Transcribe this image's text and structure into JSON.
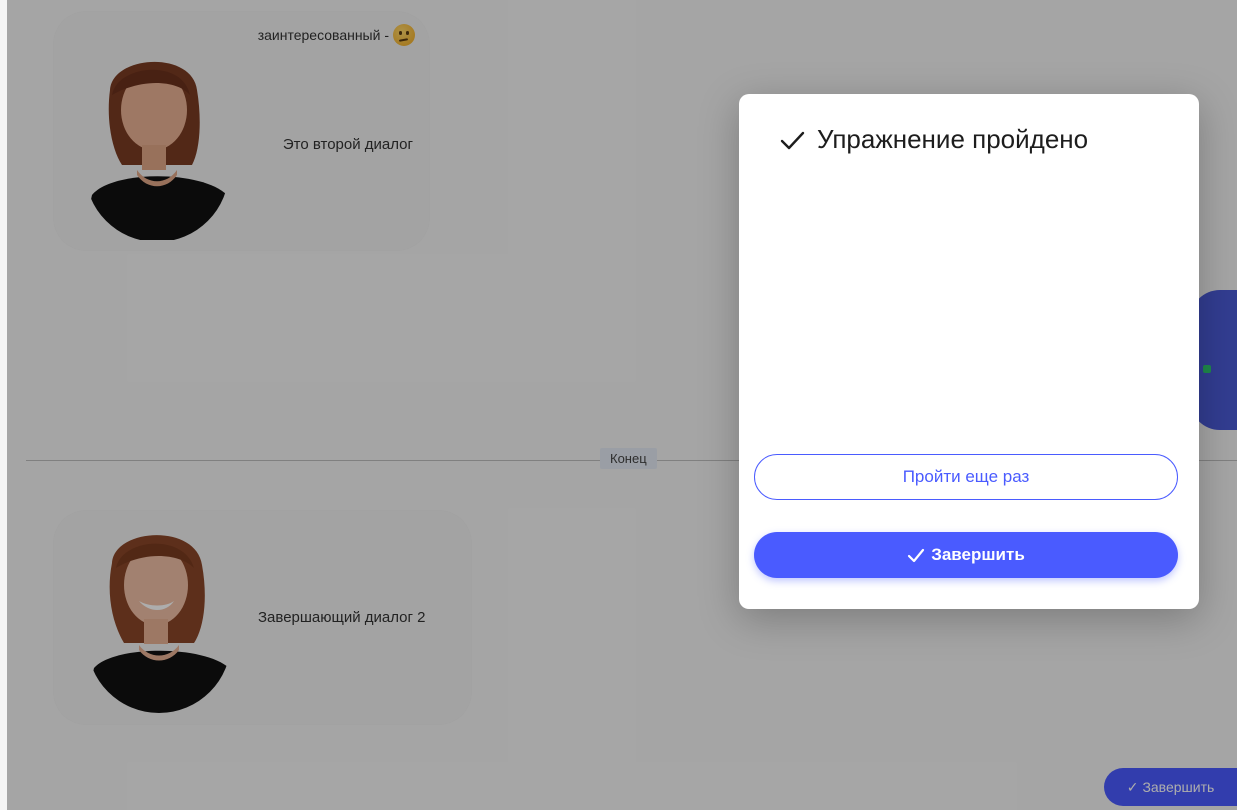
{
  "dialogs": [
    {
      "mood_label": "заинтересованный -",
      "mood_icon": "thinking-face-emoji",
      "text": "Это второй диалог"
    },
    {
      "text": "Завершающий диалог 2"
    }
  ],
  "divider": {
    "label": "Конец"
  },
  "fab": {
    "label": "Завершить",
    "icon": "check-icon"
  },
  "modal": {
    "title": "Упражнение пройдено",
    "title_icon": "check-icon",
    "retry_label": "Пройти еще раз",
    "finish_label": "Завершить"
  },
  "colors": {
    "accent": "#4a5bff",
    "overlay": "rgba(0,0,0,0.32)",
    "card_bg": "#f1f1f1"
  }
}
